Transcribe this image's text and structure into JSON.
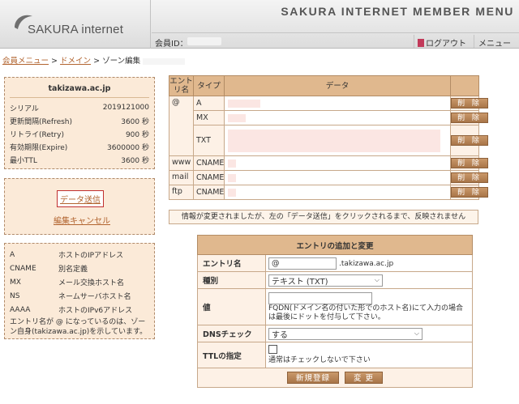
{
  "header": {
    "logo_text": "SAKURA internet",
    "menu_title": "SAKURA INTERNET MEMBER MENU",
    "member_id_label": "会員ID：",
    "logout_label": "ログアウト",
    "menu_label": "メニュー"
  },
  "breadcrumb": {
    "home": "会員メニュー",
    "domain": "ドメイン",
    "current": "ゾーン編集"
  },
  "zone": {
    "domain": "takizawa.ac.jp",
    "rows": [
      {
        "label": "シリアル",
        "value": "2019121000"
      },
      {
        "label": "更新間隔(Refresh)",
        "value": "3600 秒"
      },
      {
        "label": "リトライ(Retry)",
        "value": "900 秒"
      },
      {
        "label": "有効期限(Expire)",
        "value": "3600000 秒"
      },
      {
        "label": "最小TTL",
        "value": "3600 秒"
      }
    ]
  },
  "actions": {
    "send_label": "データ送信",
    "cancel_label": "編集キャンセル"
  },
  "legend": {
    "rows": [
      {
        "type": "A",
        "desc": "ホストのIPアドレス"
      },
      {
        "type": "CNAME",
        "desc": "別名定義"
      },
      {
        "type": "MX",
        "desc": "メール交換ホスト名"
      },
      {
        "type": "NS",
        "desc": "ネームサーバホスト名"
      },
      {
        "type": "AAAA",
        "desc": "ホストのIPv6アドレス"
      }
    ],
    "note": "エントリ名が @ になっているのは、ゾーン自身(takizawa.ac.jp)を示しています。"
  },
  "records": {
    "headers": {
      "entry": "エントリ名",
      "type": "タイプ",
      "data": "データ"
    },
    "delete_label": "削 除",
    "groups": [
      {
        "entry": "@",
        "types": [
          "A",
          "MX",
          "TXT"
        ]
      },
      {
        "entry": "www",
        "types": [
          "CNAME"
        ]
      },
      {
        "entry": "mail",
        "types": [
          "CNAME"
        ]
      },
      {
        "entry": "ftp",
        "types": [
          "CNAME"
        ]
      }
    ]
  },
  "notice": "情報が変更されましたが、左の「データ送信」をクリックされるまで、反映されません",
  "form": {
    "title": "エントリの追加と変更",
    "entry_label": "エントリ名",
    "entry_value": "@",
    "entry_suffix": ".takizawa.ac.jp",
    "type_label": "種別",
    "type_value": "テキスト (TXT)",
    "value_label": "値",
    "value_hint": "FQDN(ドメイン名の付いた形でのホスト名)にて入力の場合は最後にドットを付与して下さい。",
    "dns_label": "DNSチェック",
    "dns_value": "する",
    "ttl_label": "TTLの指定",
    "ttl_hint": "通常はチェックしないで下さい",
    "submit_label": "新規登録",
    "change_label": "変 更"
  },
  "colors": {
    "panel_bg": "#fbead8",
    "header_cell": "#e0b88e",
    "button": "#b88659",
    "link": "#b2642f"
  }
}
